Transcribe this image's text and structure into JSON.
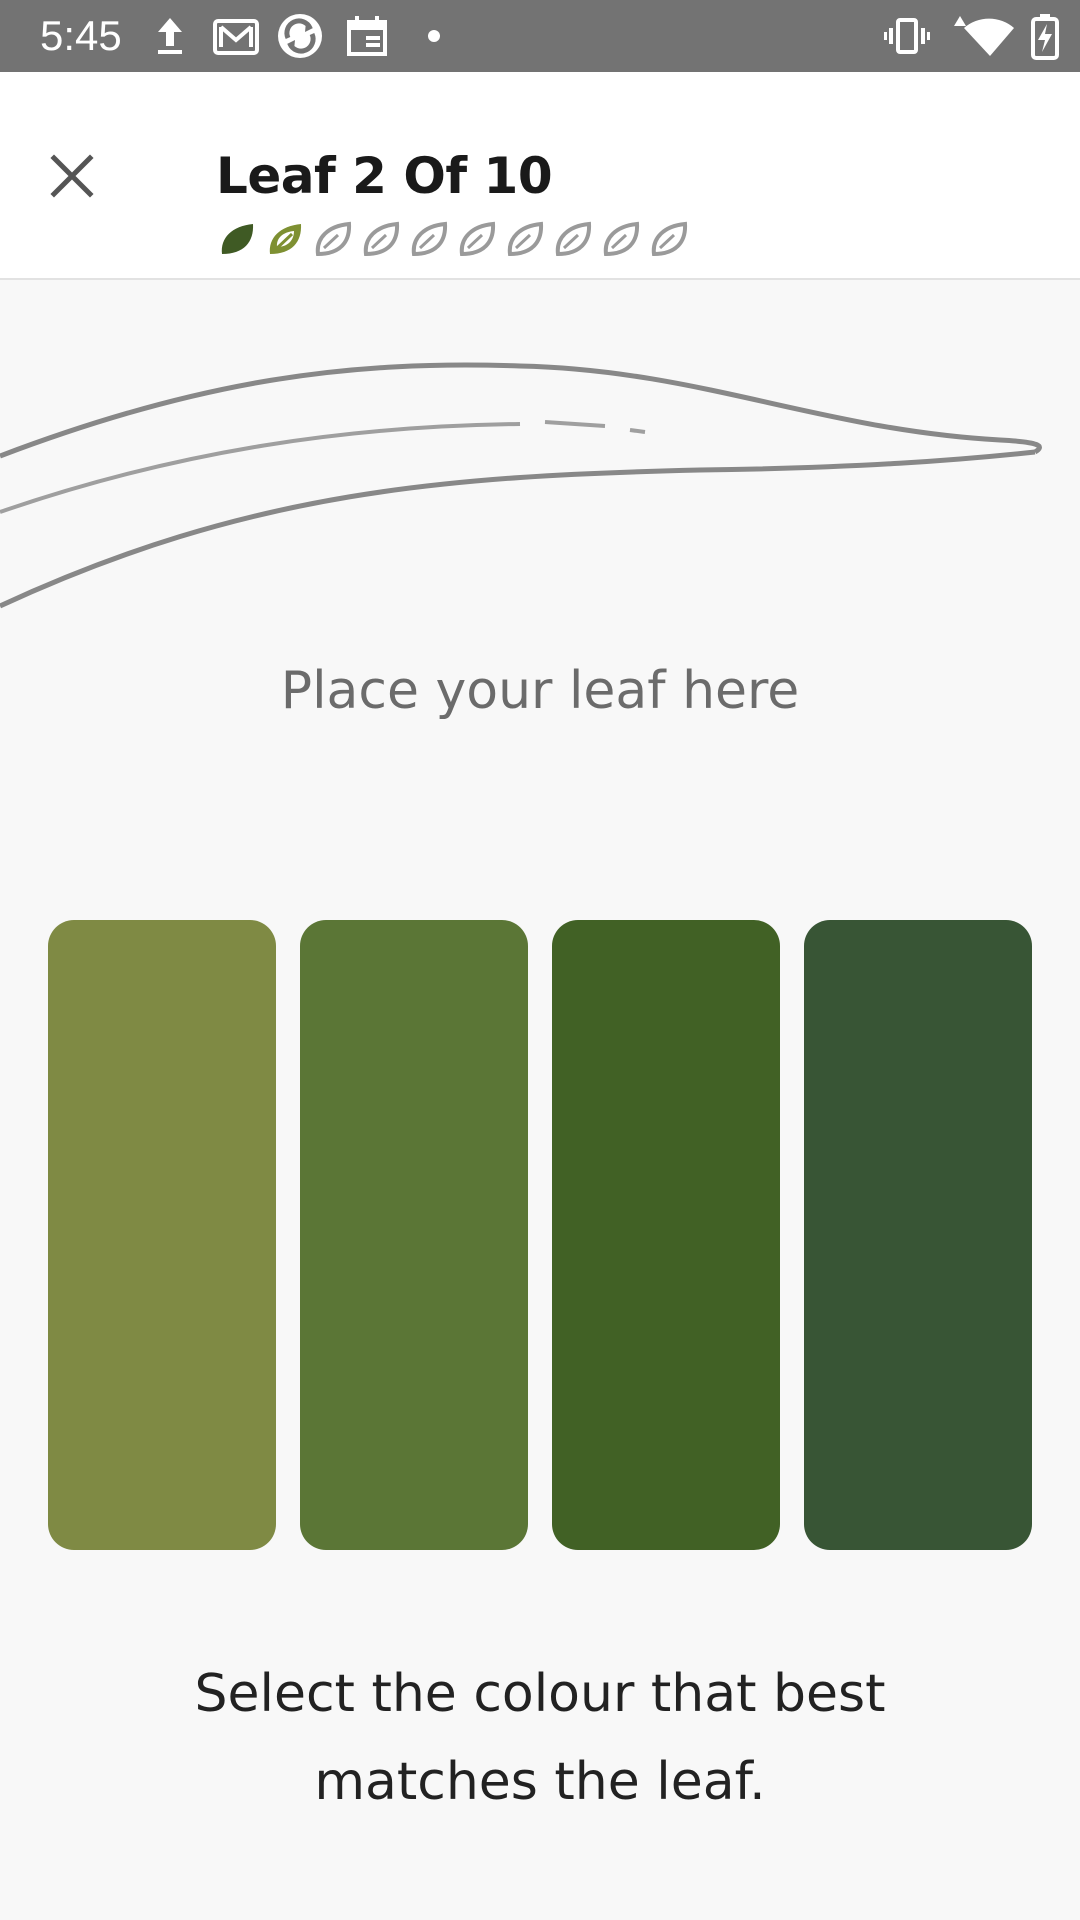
{
  "status_bar": {
    "time": "5:45",
    "left_icons": [
      "upload-icon",
      "gmail-icon",
      "sync-app-icon",
      "calendar-icon",
      "notification-dot-icon"
    ],
    "right_icons": [
      "vibrate-icon",
      "wifi-icon",
      "battery-charging-icon"
    ]
  },
  "header": {
    "title": "Leaf 2 Of 10",
    "close_icon": "close-icon",
    "progress": {
      "current": 2,
      "total": 10,
      "completed_color": "#3f5a24",
      "current_color": "#7e9032",
      "pending_color": "#9a9a9a"
    }
  },
  "leaf_area": {
    "hint": "Place your leaf here",
    "outline_color": "#888888"
  },
  "swatches": [
    {
      "color": "#7f8a44"
    },
    {
      "color": "#5b7636"
    },
    {
      "color": "#416125"
    },
    {
      "color": "#385535"
    }
  ],
  "instruction": "Select the colour that best matches the leaf."
}
